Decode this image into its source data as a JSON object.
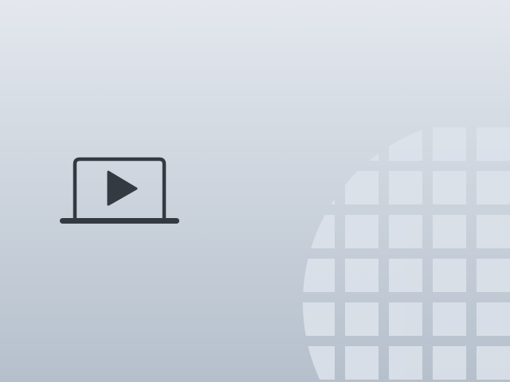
{
  "scene": {
    "description_icon": "laptop-video-play-icon",
    "decoration": "waffle-grid-icon",
    "colors": {
      "background_top": "#e4e8ee",
      "background_bottom": "#b5c0cc",
      "icon": "#343a42",
      "grid_tile": "#dde3eb"
    }
  }
}
